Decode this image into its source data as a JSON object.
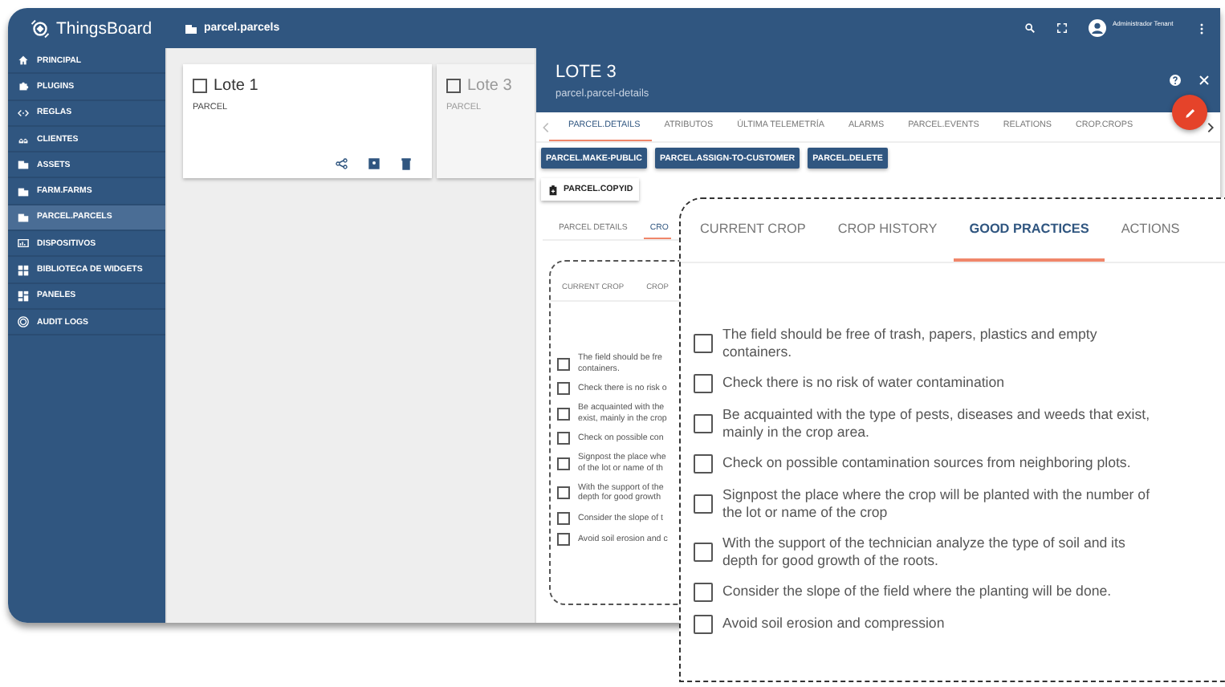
{
  "header": {
    "logo": "ThingsBoard",
    "breadcrumb": "parcel.parcels",
    "user": "Administrador Tenant"
  },
  "sidebar": {
    "items": [
      {
        "label": "PRINCIPAL",
        "selected": false
      },
      {
        "label": "PLUGINS",
        "selected": false
      },
      {
        "label": "REGLAS",
        "selected": false
      },
      {
        "label": "CLIENTES",
        "selected": false
      },
      {
        "label": "ASSETS",
        "selected": false
      },
      {
        "label": "FARM.FARMS",
        "selected": false
      },
      {
        "label": "PARCEL.PARCELS",
        "selected": true
      },
      {
        "label": "DISPOSITIVOS",
        "selected": false
      },
      {
        "label": "BIBLIOTECA DE WIDGETS",
        "selected": false
      },
      {
        "label": "PANELES",
        "selected": false
      },
      {
        "label": "AUDIT LOGS",
        "selected": false
      }
    ]
  },
  "cards": [
    {
      "title": "Lote 1",
      "subtitle": "PARCEL",
      "checked": false,
      "selected": false
    },
    {
      "title": "Lote 3",
      "subtitle": "PARCEL",
      "checked": false,
      "selected": true
    }
  ],
  "details": {
    "title": "LOTE 3",
    "subtitle": "parcel.parcel-details",
    "tabs": [
      {
        "label": "PARCEL.DETAILS",
        "selected": true
      },
      {
        "label": "ATRIBUTOS",
        "selected": false
      },
      {
        "label": "ÚLTIMA TELEMETRÍA",
        "selected": false
      },
      {
        "label": "ALARMS",
        "selected": false
      },
      {
        "label": "PARCEL.EVENTS",
        "selected": false
      },
      {
        "label": "RELATIONS",
        "selected": false
      },
      {
        "label": "CROP.CROPS",
        "selected": false
      }
    ],
    "buttons": [
      "PARCEL.MAKE-PUBLIC",
      "PARCEL.ASSIGN-TO-CUSTOMER",
      "PARCEL.DELETE"
    ],
    "copy_button": "PARCEL.COPYID",
    "subtabs": [
      {
        "label": "PARCEL DETAILS",
        "selected": false
      },
      {
        "label": "CRO",
        "selected": true
      }
    ],
    "callout": {
      "tabs": [
        "CURRENT CROP",
        "CROP"
      ],
      "items": [
        {
          "lines": [
            "The field should be fre",
            "containers."
          ],
          "checked": false
        },
        {
          "lines": [
            "Check there is no risk o"
          ],
          "checked": false
        },
        {
          "lines": [
            "Be acquainted with the",
            "exist, mainly in the crop"
          ],
          "checked": false
        },
        {
          "lines": [
            "Check on possible con"
          ],
          "checked": false
        },
        {
          "lines": [
            "Signpost the place whe",
            "of the lot or name of th"
          ],
          "checked": false
        },
        {
          "lines": [
            "With the support of the",
            "depth for good growth"
          ],
          "checked": false
        },
        {
          "lines": [
            "Consider the slope of t"
          ],
          "checked": false
        },
        {
          "lines": [
            "Avoid soil erosion and c"
          ],
          "checked": false
        }
      ]
    }
  },
  "zoom_callout": {
    "tabs": [
      {
        "label": "CURRENT CROP",
        "selected": false
      },
      {
        "label": "CROP HISTORY",
        "selected": false
      },
      {
        "label": "GOOD PRACTICES",
        "selected": true
      },
      {
        "label": "ACTIONS",
        "selected": false
      }
    ],
    "items": [
      {
        "text": "The field should be free of trash, papers, plastics and empty containers.",
        "checked": false
      },
      {
        "text": "Check there is no risk of water contamination",
        "checked": false
      },
      {
        "text": "Be acquainted with the type of pests, diseases and weeds that exist, mainly in the crop area.",
        "checked": false
      },
      {
        "text": "Check on possible contamination sources from neighboring plots.",
        "checked": false
      },
      {
        "text": "Signpost the place where the crop will be planted with the number of the lot or name of the crop",
        "checked": false
      },
      {
        "text": "With the support of the technician analyze the type of soil and its depth for good growth of the roots.",
        "checked": false
      },
      {
        "text": "Consider the slope of the field where the planting will be done.",
        "checked": false
      },
      {
        "text": "Avoid soil erosion and compression",
        "checked": false
      }
    ]
  }
}
